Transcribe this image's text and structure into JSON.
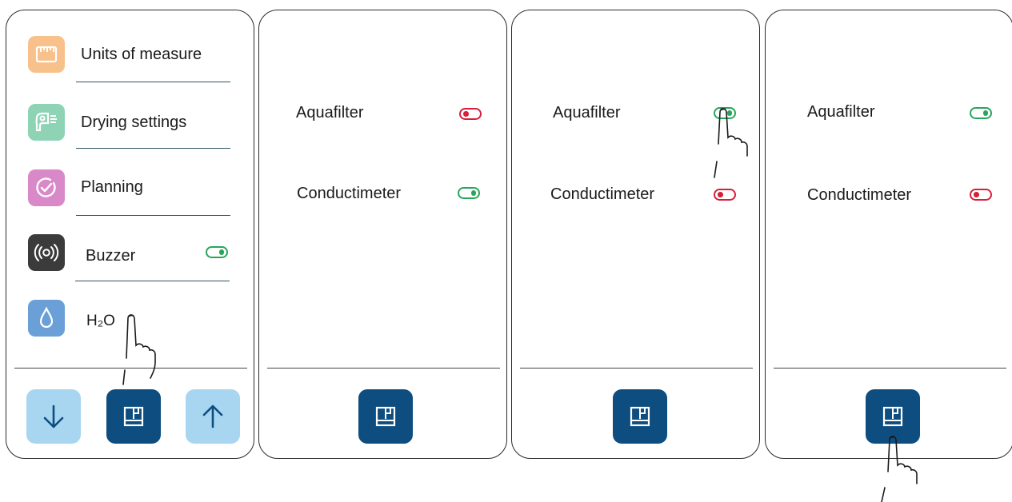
{
  "panels": {
    "menu": {
      "items": [
        {
          "label": "Units of measure",
          "icon": "ruler-icon",
          "color": "#f8c08a"
        },
        {
          "label": "Drying settings",
          "icon": "hair-dryer-icon",
          "color": "#8fd3b5"
        },
        {
          "label": "Planning",
          "icon": "clock-check-icon",
          "color": "#d988c8"
        },
        {
          "label": "Buzzer",
          "icon": "sound-waves-icon",
          "color": "#3b3b3b",
          "toggle": "on"
        },
        {
          "label": "H₂O",
          "icon": "water-drop-icon",
          "color": "#6a9fd8"
        }
      ],
      "footer": {
        "down_icon": "arrow-down-icon",
        "confirm_icon": "confirm-icon",
        "up_icon": "arrow-up-icon"
      }
    },
    "water_before": {
      "aquafilter": {
        "label": "Aquafilter",
        "toggle": "off"
      },
      "conductimeter": {
        "label": "Conductimeter",
        "toggle": "on"
      }
    },
    "water_tapping": {
      "aquafilter": {
        "label": "Aquafilter",
        "toggle": "on"
      },
      "conductimeter": {
        "label": "Conductimeter",
        "toggle": "off"
      }
    },
    "water_after": {
      "aquafilter": {
        "label": "Aquafilter",
        "toggle": "on"
      },
      "conductimeter": {
        "label": "Conductimeter",
        "toggle": "off"
      }
    }
  },
  "colors": {
    "toggle_on": "#27a65a",
    "toggle_off": "#d81e3a",
    "button_dark": "#0d4d80",
    "button_light": "#a8d6f1",
    "divider": "#2e5563"
  }
}
